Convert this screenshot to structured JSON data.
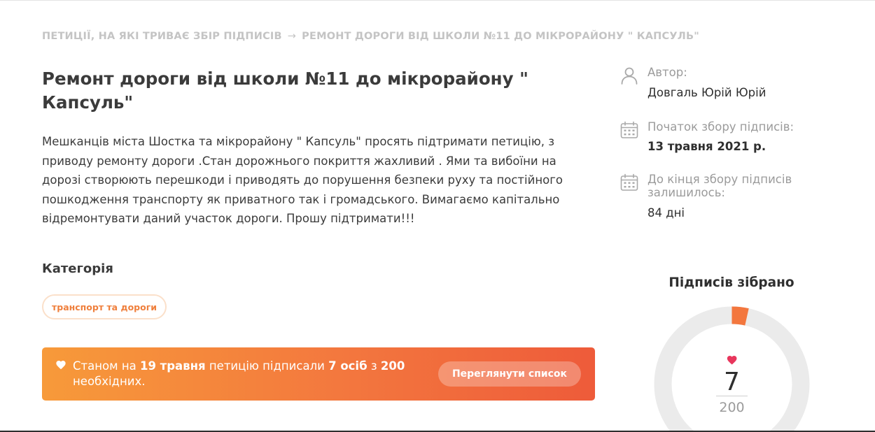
{
  "breadcrumb": {
    "parent": "ПЕТИЦІЇ, НА ЯКІ ТРИВАЄ ЗБІР ПІДПИСІВ",
    "separator": "→",
    "current": "РЕМОНТ ДОРОГИ ВІД ШКОЛИ №11 ДО МІКРОРАЙОНУ \" КАПСУЛЬ\""
  },
  "petition": {
    "title": "Ремонт дороги від школи №11 до мікрорайону \" Капсуль\"",
    "description": "Мешканців міста Шостка та мікрорайону \" Капсуль\" просять підтримати петицію, з приводу ремонту дороги .Стан дорожнього покриття жахливий . Ями та вибоїни на дорозі створюють перешкоди і приводять до порушення безпеки руху та постійного пошкодження транспорту як приватного так і громадського. Вимагаємо капітально відремонтувати даний участок дороги. Прошу підтримати!!!",
    "category_heading": "Категорія",
    "category_tag": "транспорт та дороги"
  },
  "status": {
    "prefix": "Станом на",
    "date": "19 травня",
    "middle": "петицію підписали",
    "count_text": "7 осіб",
    "from": "з",
    "goal_text": "200",
    "suffix": "необхідних.",
    "button_label": "Переглянути список",
    "icon": "heart-icon"
  },
  "sidebar": {
    "author_label": "Автор:",
    "author_name": "Довгаль Юрій Юрій",
    "start_label": "Початок збору підписів:",
    "start_date": "13 травня 2021 р.",
    "remaining_label": "До кінця збору підписів залишилось:",
    "remaining_value": "84 дні"
  },
  "signatures": {
    "heading": "Підписів зібрано",
    "collected": 7,
    "goal": 200
  },
  "colors": {
    "accent": "#f3773e",
    "accent_dark": "#ee5b3a",
    "accent_light": "#f79a3a",
    "ring_track": "#ebebeb",
    "heart": "#e8365c",
    "muted_text": "#c4c4c4",
    "tag_border": "#fbe0ca"
  }
}
